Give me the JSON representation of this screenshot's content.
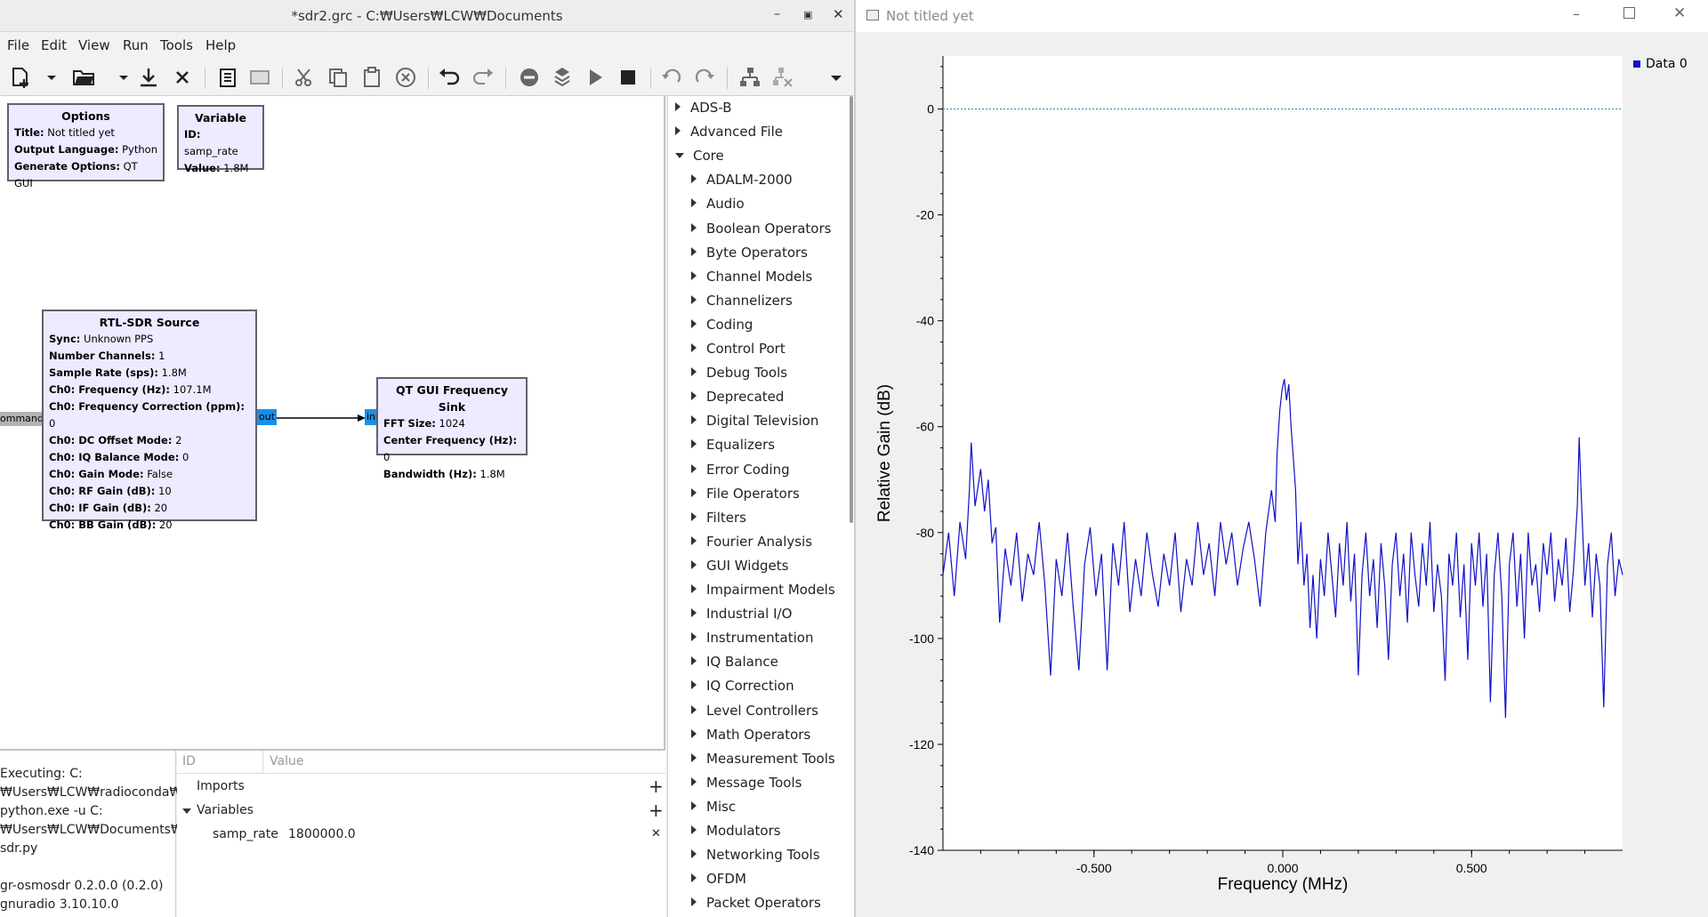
{
  "grc_window": {
    "title": "*sdr2.grc - C:₩Users₩LCW₩Documents",
    "menu": [
      "File",
      "Edit",
      "View",
      "Run",
      "Tools",
      "Help"
    ]
  },
  "blocks": {
    "options": {
      "title": "Options",
      "rows": [
        {
          "k": "Title:",
          "v": "Not titled yet"
        },
        {
          "k": "Output Language:",
          "v": "Python"
        },
        {
          "k": "Generate Options:",
          "v": "QT GUI"
        }
      ]
    },
    "variable": {
      "title": "Variable",
      "rows": [
        {
          "k": "ID:",
          "v": "samp_rate"
        },
        {
          "k": "Value:",
          "v": "1.8M"
        }
      ]
    },
    "rtlsdr": {
      "title": "RTL-SDR Source",
      "rows": [
        {
          "k": "Sync:",
          "v": "Unknown PPS"
        },
        {
          "k": "Number Channels:",
          "v": "1"
        },
        {
          "k": "Sample Rate (sps):",
          "v": "1.8M"
        },
        {
          "k": "Ch0: Frequency (Hz):",
          "v": "107.1M"
        },
        {
          "k": "Ch0: Frequency Correction (ppm):",
          "v": "0"
        },
        {
          "k": "Ch0: DC Offset Mode:",
          "v": "2"
        },
        {
          "k": "Ch0: IQ Balance Mode:",
          "v": "0"
        },
        {
          "k": "Ch0: Gain Mode:",
          "v": "False"
        },
        {
          "k": "Ch0: RF Gain (dB):",
          "v": "10"
        },
        {
          "k": "Ch0: IF Gain (dB):",
          "v": "20"
        },
        {
          "k": "Ch0: BB Gain (dB):",
          "v": "20"
        }
      ],
      "out_port": "out",
      "cmd_port": "ommand"
    },
    "freqsink": {
      "title": "QT GUI Frequency Sink",
      "rows": [
        {
          "k": "FFT Size:",
          "v": "1024"
        },
        {
          "k": "Center Frequency (Hz):",
          "v": "0"
        },
        {
          "k": "Bandwidth (Hz):",
          "v": "1.8M"
        }
      ],
      "in_port": "in"
    }
  },
  "console": {
    "lines": [
      "Executing: C:",
      "₩Users₩LCW₩radioconda₩",
      "python.exe -u C:",
      "₩Users₩LCW₩Documents₩",
      "sdr.py",
      "",
      "gr-osmosdr 0.2.0.0 (0.2.0)",
      "gnuradio 3.10.10.0"
    ]
  },
  "variables_panel": {
    "col_id": "ID",
    "col_value": "Value",
    "imports_label": "Imports",
    "variables_label": "Variables",
    "var_name": "samp_rate",
    "var_value": "1800000.0"
  },
  "block_tree": {
    "top": [
      {
        "label": "ADS-B",
        "open": false
      },
      {
        "label": "Advanced File",
        "open": false
      },
      {
        "label": "Core",
        "open": true
      }
    ],
    "core_children": [
      "ADALM-2000",
      "Audio",
      "Boolean Operators",
      "Byte Operators",
      "Channel Models",
      "Channelizers",
      "Coding",
      "Control Port",
      "Debug Tools",
      "Deprecated",
      "Digital Television",
      "Equalizers",
      "Error Coding",
      "File Operators",
      "Filters",
      "Fourier Analysis",
      "GUI Widgets",
      "Impairment Models",
      "Industrial I/O",
      "Instrumentation",
      "IQ Balance",
      "IQ Correction",
      "Level Controllers",
      "Math Operators",
      "Measurement Tools",
      "Message Tools",
      "Misc",
      "Modulators",
      "Networking Tools",
      "OFDM",
      "Packet Operators"
    ]
  },
  "plot_window": {
    "title": "Not titled yet"
  },
  "chart_data": {
    "type": "line",
    "xlabel": "Frequency (MHz)",
    "ylabel": "Relative Gain (dB)",
    "xlim": [
      -0.9,
      0.9
    ],
    "ylim": [
      -140,
      10
    ],
    "xticks": [
      -0.5,
      0.0,
      0.5
    ],
    "xtick_labels": [
      "-0.500",
      "0.000",
      "0.500"
    ],
    "yticks": [
      0,
      -20,
      -40,
      -60,
      -80,
      -100,
      -120,
      -140
    ],
    "ytick_labels": [
      "0",
      "-20",
      "-40",
      "-60",
      "-80",
      "-100",
      "-120",
      "-140"
    ],
    "grid": false,
    "legend": "top-right",
    "series": [
      {
        "name": "Data 0",
        "color": "#1010c8",
        "points": [
          [
            -0.9,
            -88
          ],
          [
            -0.885,
            -80
          ],
          [
            -0.87,
            -92
          ],
          [
            -0.855,
            -78
          ],
          [
            -0.84,
            -85
          ],
          [
            -0.83,
            -72
          ],
          [
            -0.825,
            -63
          ],
          [
            -0.815,
            -75
          ],
          [
            -0.8,
            -68
          ],
          [
            -0.79,
            -76
          ],
          [
            -0.78,
            -70
          ],
          [
            -0.77,
            -82
          ],
          [
            -0.76,
            -79
          ],
          [
            -0.75,
            -97
          ],
          [
            -0.735,
            -83
          ],
          [
            -0.72,
            -90
          ],
          [
            -0.705,
            -80
          ],
          [
            -0.69,
            -93
          ],
          [
            -0.675,
            -84
          ],
          [
            -0.66,
            -88
          ],
          [
            -0.645,
            -78
          ],
          [
            -0.63,
            -90
          ],
          [
            -0.615,
            -107
          ],
          [
            -0.6,
            -85
          ],
          [
            -0.585,
            -92
          ],
          [
            -0.57,
            -80
          ],
          [
            -0.555,
            -94
          ],
          [
            -0.54,
            -106
          ],
          [
            -0.525,
            -86
          ],
          [
            -0.51,
            -79
          ],
          [
            -0.495,
            -92
          ],
          [
            -0.48,
            -84
          ],
          [
            -0.465,
            -106
          ],
          [
            -0.45,
            -82
          ],
          [
            -0.435,
            -90
          ],
          [
            -0.42,
            -78
          ],
          [
            -0.405,
            -95
          ],
          [
            -0.39,
            -85
          ],
          [
            -0.375,
            -92
          ],
          [
            -0.36,
            -80
          ],
          [
            -0.345,
            -88
          ],
          [
            -0.33,
            -94
          ],
          [
            -0.315,
            -84
          ],
          [
            -0.3,
            -90
          ],
          [
            -0.285,
            -80
          ],
          [
            -0.27,
            -95
          ],
          [
            -0.255,
            -85
          ],
          [
            -0.24,
            -90
          ],
          [
            -0.225,
            -78
          ],
          [
            -0.21,
            -88
          ],
          [
            -0.195,
            -82
          ],
          [
            -0.18,
            -92
          ],
          [
            -0.165,
            -78
          ],
          [
            -0.15,
            -86
          ],
          [
            -0.135,
            -80
          ],
          [
            -0.12,
            -90
          ],
          [
            -0.105,
            -83
          ],
          [
            -0.09,
            -78
          ],
          [
            -0.075,
            -85
          ],
          [
            -0.06,
            -94
          ],
          [
            -0.045,
            -80
          ],
          [
            -0.03,
            -72
          ],
          [
            -0.02,
            -78
          ],
          [
            -0.015,
            -65
          ],
          [
            -0.008,
            -57
          ],
          [
            -0.002,
            -53
          ],
          [
            0.004,
            -51
          ],
          [
            0.01,
            -55
          ],
          [
            0.016,
            -52
          ],
          [
            0.022,
            -60
          ],
          [
            0.028,
            -66
          ],
          [
            0.034,
            -72
          ],
          [
            0.04,
            -86
          ],
          [
            0.048,
            -78
          ],
          [
            0.056,
            -90
          ],
          [
            0.064,
            -84
          ],
          [
            0.072,
            -98
          ],
          [
            0.08,
            -88
          ],
          [
            0.09,
            -100
          ],
          [
            0.1,
            -85
          ],
          [
            0.11,
            -92
          ],
          [
            0.12,
            -80
          ],
          [
            0.13,
            -88
          ],
          [
            0.14,
            -96
          ],
          [
            0.15,
            -82
          ],
          [
            0.16,
            -90
          ],
          [
            0.17,
            -78
          ],
          [
            0.18,
            -93
          ],
          [
            0.19,
            -84
          ],
          [
            0.2,
            -107
          ],
          [
            0.21,
            -88
          ],
          [
            0.22,
            -80
          ],
          [
            0.23,
            -92
          ],
          [
            0.24,
            -85
          ],
          [
            0.25,
            -98
          ],
          [
            0.26,
            -82
          ],
          [
            0.27,
            -90
          ],
          [
            0.28,
            -104
          ],
          [
            0.29,
            -86
          ],
          [
            0.3,
            -80
          ],
          [
            0.31,
            -92
          ],
          [
            0.32,
            -84
          ],
          [
            0.33,
            -97
          ],
          [
            0.34,
            -80
          ],
          [
            0.35,
            -88
          ],
          [
            0.36,
            -94
          ],
          [
            0.37,
            -82
          ],
          [
            0.38,
            -90
          ],
          [
            0.39,
            -78
          ],
          [
            0.4,
            -95
          ],
          [
            0.41,
            -86
          ],
          [
            0.42,
            -92
          ],
          [
            0.43,
            -108
          ],
          [
            0.44,
            -84
          ],
          [
            0.45,
            -90
          ],
          [
            0.46,
            -80
          ],
          [
            0.47,
            -96
          ],
          [
            0.48,
            -86
          ],
          [
            0.49,
            -104
          ],
          [
            0.5,
            -82
          ],
          [
            0.51,
            -90
          ],
          [
            0.52,
            -80
          ],
          [
            0.53,
            -94
          ],
          [
            0.54,
            -84
          ],
          [
            0.55,
            -112
          ],
          [
            0.56,
            -88
          ],
          [
            0.57,
            -80
          ],
          [
            0.58,
            -92
          ],
          [
            0.59,
            -115
          ],
          [
            0.6,
            -86
          ],
          [
            0.61,
            -80
          ],
          [
            0.62,
            -94
          ],
          [
            0.63,
            -84
          ],
          [
            0.64,
            -100
          ],
          [
            0.65,
            -80
          ],
          [
            0.66,
            -90
          ],
          [
            0.67,
            -86
          ],
          [
            0.68,
            -95
          ],
          [
            0.69,
            -82
          ],
          [
            0.7,
            -88
          ],
          [
            0.71,
            -80
          ],
          [
            0.72,
            -93
          ],
          [
            0.73,
            -85
          ],
          [
            0.74,
            -90
          ],
          [
            0.75,
            -81
          ],
          [
            0.76,
            -95
          ],
          [
            0.77,
            -87
          ],
          [
            0.78,
            -75
          ],
          [
            0.785,
            -62
          ],
          [
            0.79,
            -72
          ],
          [
            0.8,
            -90
          ],
          [
            0.81,
            -82
          ],
          [
            0.82,
            -96
          ],
          [
            0.83,
            -84
          ],
          [
            0.84,
            -90
          ],
          [
            0.85,
            -113
          ],
          [
            0.86,
            -86
          ],
          [
            0.87,
            -80
          ],
          [
            0.88,
            -92
          ],
          [
            0.89,
            -85
          ],
          [
            0.9,
            -88
          ]
        ]
      },
      {
        "name": "",
        "color": "#3a9aaa",
        "style": "dotted",
        "points": [
          [
            -0.9,
            0
          ],
          [
            0.9,
            0
          ]
        ]
      }
    ]
  }
}
